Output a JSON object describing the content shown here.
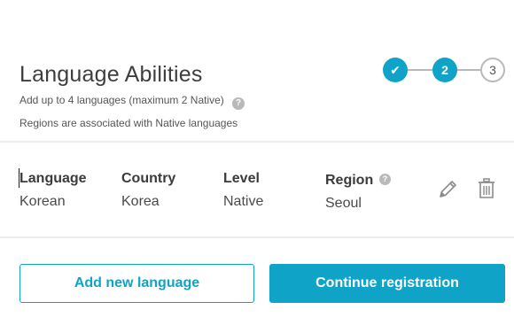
{
  "header": {
    "title": "Language Abilities",
    "subtitle": "Add up to 4 languages (maximum 2 Native)",
    "note": "Regions are associated with Native languages",
    "help_glyph": "?"
  },
  "stepper": {
    "steps": [
      {
        "label": "✔",
        "state": "completed"
      },
      {
        "label": "2",
        "state": "current"
      },
      {
        "label": "3",
        "state": "upcoming"
      }
    ]
  },
  "language_row": {
    "language_label": "Language",
    "language_value": "Korean",
    "country_label": "Country",
    "country_value": "Korea",
    "level_label": "Level",
    "level_value": "Native",
    "region_label": "Region",
    "region_value": "Seoul",
    "region_help_glyph": "?",
    "edit_icon": "pencil-icon",
    "delete_icon": "trash-icon"
  },
  "actions": {
    "add_label": "Add new language",
    "continue_label": "Continue registration"
  },
  "colors": {
    "accent": "#0fa3c7",
    "muted": "#b9b9b9"
  }
}
